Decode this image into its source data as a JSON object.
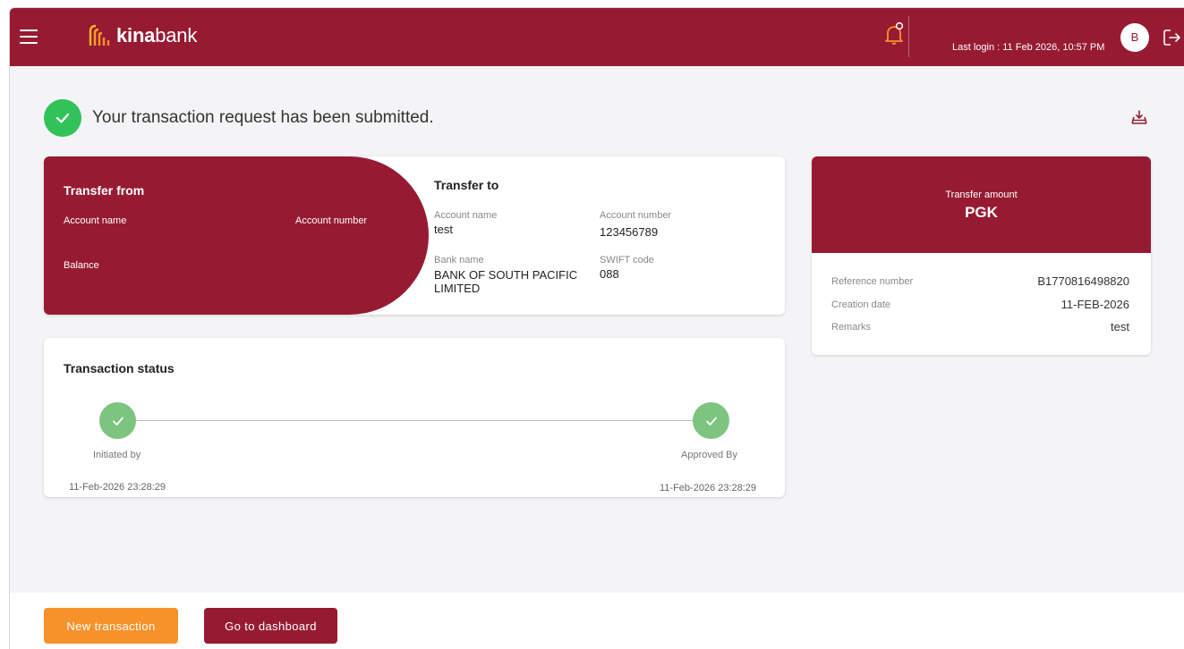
{
  "header": {
    "logo_bold": "kina",
    "logo_light": "bank",
    "last_login": "Last login : 11 Feb 2026, 10:57 PM",
    "avatar_initial": "B",
    "icons": [
      "menu-icon",
      "bell-icon",
      "logout-icon"
    ],
    "brand_color": "#961b32"
  },
  "banner": {
    "message": "Your transaction request has been submitted.",
    "icons": [
      "check-circle-icon",
      "download-icon"
    ],
    "success_color": "#31c25a"
  },
  "transfer_from": {
    "title": "Transfer from",
    "account_name_label": "Account name",
    "account_number_label": "Account number",
    "balance_label": "Balance"
  },
  "transfer_to": {
    "title": "Transfer to",
    "account_name_label": "Account name",
    "account_name": "test",
    "account_number_label": "Account number",
    "account_number": "123456789",
    "bank_name_label": "Bank name",
    "bank_name_line1": "BANK OF SOUTH PACIFIC",
    "bank_name_line2": "LIMITED",
    "swift_label": "SWIFT code",
    "swift": "088"
  },
  "amount": {
    "label": "Transfer amount",
    "currency": "PGK",
    "reference_label": "Reference number",
    "reference": "B1770816498820",
    "creation_label": "Creation date",
    "creation_date": "11-FEB-2026",
    "remarks_label": "Remarks",
    "remarks": "test"
  },
  "status": {
    "title": "Transaction status",
    "steps": [
      {
        "label": "Initiated by",
        "date": "11-Feb-2026 23:28:29"
      },
      {
        "label": "Approved By",
        "date": "11-Feb-2026 23:28:29"
      }
    ],
    "step_color": "#7dc47f"
  },
  "footer": {
    "new_transaction": "New transaction",
    "dashboard": "Go to dashboard",
    "accent_color": "#f7922a"
  }
}
